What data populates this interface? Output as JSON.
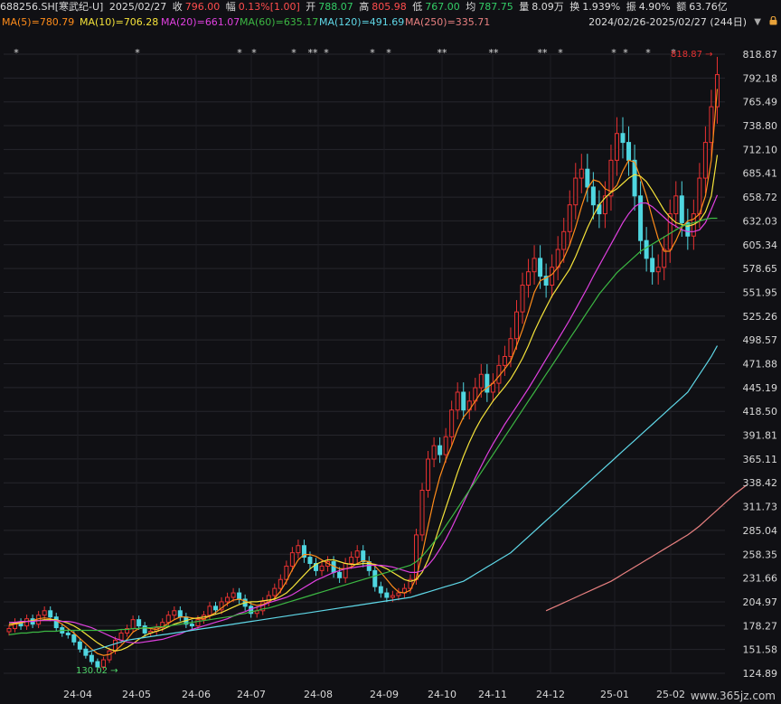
{
  "header": {
    "code": "688256.SH[寒武纪-U]",
    "date": "2025/02/27",
    "close_label": "收",
    "close": "796.00",
    "chg_label": "幅",
    "chg": "0.13%[1.00]",
    "open_label": "开",
    "open": "788.07",
    "high_label": "高",
    "high": "805.98",
    "low_label": "低",
    "low": "767.00",
    "avg_label": "均",
    "avg": "787.75",
    "vol_label": "量",
    "vol": "8.09万",
    "turn_label": "换",
    "turn": "1.939%",
    "amp_label": "振",
    "amp": "4.90%",
    "amt_label": "额",
    "amt": "63.76亿"
  },
  "ma_legend": [
    {
      "text": "MA(5)=780.79",
      "color": "#ff8c1a"
    },
    {
      "text": "MA(10)=706.28",
      "color": "#f5e33a"
    },
    {
      "text": "MA(20)=661.07",
      "color": "#e040e0"
    },
    {
      "text": "MA(60)=635.17",
      "color": "#3cb843"
    },
    {
      "text": "MA(120)=491.69",
      "color": "#5fd8e8"
    },
    {
      "text": "MA(250)=335.71",
      "color": "#e88080"
    }
  ],
  "range_text": "2024/02/26-2025/02/27 (244日)",
  "watermark": "www.365jz.com",
  "chart_data": {
    "type": "candlestick",
    "title": "",
    "y_ticks": [
      "818.87",
      "792.18",
      "765.49",
      "738.80",
      "712.10",
      "685.41",
      "658.72",
      "632.03",
      "605.34",
      "578.65",
      "551.95",
      "525.26",
      "498.57",
      "471.88",
      "445.19",
      "418.50",
      "391.81",
      "365.11",
      "338.42",
      "311.73",
      "285.04",
      "258.35",
      "231.66",
      "204.97",
      "178.27",
      "151.58",
      "124.89"
    ],
    "ylim": [
      124.89,
      818.87
    ],
    "x_ticks": [
      "24-04",
      "24-05",
      "24-06",
      "24-07",
      "24-08",
      "24-09",
      "24-10",
      "24-11",
      "24-12",
      "25-01",
      "25-02"
    ],
    "max_annotation": "818.87",
    "min_annotation": "130.02",
    "candle_closes": [
      175,
      182,
      178,
      186,
      180,
      190,
      195,
      188,
      176,
      170,
      168,
      160,
      152,
      145,
      138,
      132,
      140,
      150,
      162,
      170,
      175,
      185,
      178,
      170,
      172,
      176,
      182,
      190,
      195,
      188,
      180,
      178,
      185,
      190,
      200,
      196,
      205,
      210,
      215,
      208,
      200,
      192,
      195,
      205,
      212,
      220,
      230,
      245,
      260,
      268,
      255,
      248,
      240,
      245,
      250,
      238,
      232,
      248,
      255,
      262,
      250,
      240,
      222,
      215,
      210,
      212,
      215,
      220,
      230,
      280,
      330,
      365,
      380,
      370,
      390,
      420,
      440,
      420,
      430,
      445,
      460,
      440,
      450,
      470,
      480,
      500,
      530,
      560,
      575,
      590,
      570,
      560,
      580,
      600,
      620,
      650,
      680,
      690,
      670,
      650,
      640,
      660,
      700,
      730,
      720,
      700,
      660,
      610,
      590,
      575,
      580,
      600,
      640,
      660,
      630,
      615,
      640,
      680,
      720,
      760,
      796
    ],
    "series": [
      {
        "name": "MA(5)",
        "values": [
          178,
          180,
          181,
          183,
          184,
          186,
          187,
          186,
          184,
          180,
          175,
          170,
          164,
          158,
          152,
          147,
          145,
          146,
          150,
          156,
          163,
          171,
          175,
          176,
          175,
          174,
          177,
          181,
          185,
          188,
          188,
          187,
          186,
          186,
          189,
          193,
          198,
          203,
          207,
          208,
          206,
          203,
          201,
          202,
          205,
          209,
          217,
          228,
          241,
          252,
          258,
          258,
          256,
          252,
          248,
          245,
          242,
          242,
          244,
          248,
          251,
          250,
          245,
          238,
          230,
          222,
          216,
          215,
          218,
          232,
          258,
          290,
          320,
          345,
          364,
          380,
          398,
          412,
          420,
          430,
          440,
          445,
          450,
          458,
          466,
          475,
          492,
          510,
          530,
          552,
          565,
          568,
          572,
          580,
          590,
          605,
          625,
          648,
          668,
          678,
          676,
          668,
          665,
          672,
          688,
          700,
          698,
          680,
          660,
          635,
          612,
          598,
          598,
          610,
          625,
          632,
          634,
          640,
          660,
          700,
          780
        ]
      },
      {
        "name": "MA(10)",
        "values": [
          180,
          181,
          182,
          183,
          184,
          184,
          185,
          185,
          185,
          183,
          181,
          178,
          174,
          169,
          164,
          159,
          155,
          152,
          150,
          151,
          154,
          158,
          163,
          167,
          170,
          172,
          174,
          177,
          180,
          182,
          184,
          186,
          187,
          188,
          189,
          191,
          193,
          196,
          199,
          202,
          204,
          205,
          205,
          206,
          207,
          208,
          211,
          215,
          221,
          228,
          235,
          242,
          247,
          250,
          252,
          252,
          250,
          248,
          247,
          247,
          248,
          248,
          247,
          245,
          242,
          238,
          234,
          230,
          228,
          230,
          238,
          252,
          270,
          290,
          310,
          330,
          350,
          368,
          384,
          398,
          410,
          420,
          430,
          438,
          446,
          455,
          466,
          478,
          492,
          508,
          522,
          535,
          548,
          558,
          568,
          578,
          592,
          608,
          624,
          638,
          650,
          658,
          664,
          668,
          674,
          680,
          684,
          682,
          676,
          666,
          655,
          644,
          636,
          630,
          628,
          626,
          628,
          632,
          642,
          660,
          706
        ]
      },
      {
        "name": "MA(20)",
        "values": [
          182,
          182,
          183,
          183,
          183,
          184,
          184,
          184,
          184,
          183,
          183,
          182,
          180,
          178,
          176,
          173,
          170,
          167,
          164,
          162,
          160,
          159,
          159,
          160,
          161,
          162,
          163,
          165,
          167,
          169,
          172,
          174,
          176,
          178,
          180,
          182,
          184,
          186,
          189,
          192,
          194,
          197,
          199,
          201,
          204,
          206,
          208,
          210,
          213,
          217,
          221,
          225,
          229,
          232,
          235,
          238,
          240,
          242,
          243,
          244,
          245,
          246,
          246,
          246,
          245,
          244,
          242,
          240,
          238,
          238,
          240,
          246,
          254,
          264,
          275,
          288,
          302,
          316,
          330,
          344,
          357,
          370,
          382,
          393,
          404,
          414,
          424,
          434,
          444,
          455,
          466,
          477,
          488,
          499,
          510,
          521,
          533,
          545,
          557,
          570,
          582,
          594,
          606,
          618,
          630,
          640,
          648,
          652,
          652,
          648,
          642,
          636,
          630,
          626,
          622,
          620,
          620,
          622,
          630,
          645,
          661
        ]
      },
      {
        "name": "MA(60)",
        "values": [
          168,
          169,
          170,
          170,
          171,
          171,
          172,
          172,
          172,
          173,
          173,
          173,
          173,
          173,
          173,
          173,
          173,
          173,
          173,
          174,
          174,
          175,
          175,
          176,
          176,
          177,
          177,
          178,
          179,
          180,
          181,
          182,
          183,
          184,
          185,
          186,
          187,
          188,
          189,
          191,
          192,
          194,
          195,
          197,
          198,
          200,
          202,
          204,
          206,
          208,
          210,
          212,
          214,
          216,
          218,
          220,
          222,
          224,
          226,
          228,
          230,
          232,
          234,
          236,
          238,
          240,
          242,
          244,
          246,
          250,
          256,
          264,
          272,
          280,
          290,
          300,
          310,
          320,
          330,
          340,
          350,
          360,
          370,
          380,
          390,
          400,
          410,
          420,
          430,
          440,
          450,
          460,
          470,
          480,
          490,
          500,
          510,
          520,
          530,
          540,
          550,
          558,
          566,
          574,
          580,
          586,
          592,
          598,
          602,
          606,
          610,
          614,
          618,
          622,
          626,
          628,
          630,
          632,
          634,
          635,
          635
        ]
      },
      {
        "name": "MA(120)",
        "values": [
          null,
          null,
          null,
          null,
          null,
          null,
          null,
          null,
          null,
          null,
          null,
          null,
          null,
          148,
          150,
          152,
          154,
          156,
          158,
          160,
          162,
          163,
          164,
          165,
          166,
          167,
          168,
          169,
          170,
          171,
          172,
          173,
          174,
          175,
          176,
          177,
          178,
          179,
          180,
          181,
          182,
          183,
          184,
          185,
          186,
          187,
          188,
          189,
          190,
          191,
          192,
          193,
          194,
          195,
          196,
          197,
          198,
          199,
          200,
          201,
          202,
          203,
          204,
          205,
          206,
          207,
          208,
          209,
          210,
          212,
          214,
          216,
          218,
          220,
          222,
          224,
          226,
          228,
          232,
          236,
          240,
          244,
          248,
          252,
          256,
          260,
          266,
          272,
          278,
          284,
          290,
          296,
          302,
          308,
          314,
          320,
          326,
          332,
          338,
          344,
          350,
          356,
          362,
          368,
          374,
          380,
          386,
          392,
          398,
          404,
          410,
          416,
          422,
          428,
          434,
          440,
          450,
          460,
          470,
          480,
          492
        ]
      },
      {
        "name": "MA(250)",
        "values": [
          null,
          null,
          null,
          null,
          null,
          null,
          null,
          null,
          null,
          null,
          null,
          null,
          null,
          null,
          null,
          null,
          null,
          null,
          null,
          null,
          null,
          null,
          null,
          null,
          null,
          null,
          null,
          null,
          null,
          null,
          null,
          null,
          null,
          null,
          null,
          null,
          null,
          null,
          null,
          null,
          null,
          null,
          null,
          null,
          null,
          null,
          null,
          null,
          null,
          null,
          null,
          null,
          null,
          null,
          null,
          null,
          null,
          null,
          null,
          null,
          null,
          null,
          null,
          null,
          null,
          null,
          null,
          null,
          null,
          null,
          null,
          null,
          null,
          null,
          null,
          null,
          null,
          null,
          null,
          null,
          null,
          null,
          null,
          null,
          null,
          null,
          null,
          null,
          null,
          null,
          null,
          195,
          198,
          201,
          204,
          207,
          210,
          213,
          216,
          219,
          222,
          225,
          228,
          232,
          236,
          240,
          244,
          248,
          252,
          256,
          260,
          264,
          268,
          272,
          276,
          280,
          285,
          290,
          296,
          302,
          308,
          314,
          320,
          326,
          331,
          336
        ]
      }
    ],
    "markers": [
      "*",
      "*",
      "*",
      "*",
      "*",
      "**",
      "*",
      "*",
      "*",
      "**",
      "**",
      "**",
      "*",
      "*",
      "*",
      "*",
      "*",
      "**"
    ]
  }
}
